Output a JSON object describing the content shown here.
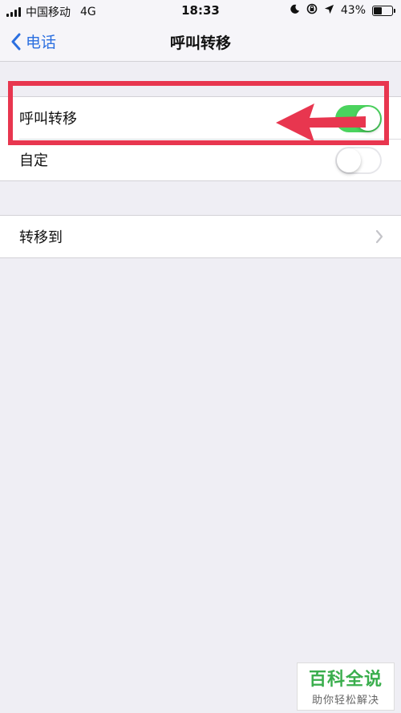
{
  "status_bar": {
    "carrier": "中国移动",
    "network": "4G",
    "time": "18:33",
    "battery_percent": "43%",
    "battery_level": 0.43,
    "icons": [
      "signal-icon",
      "moon-icon",
      "rotation-lock-icon",
      "location-icon",
      "battery-icon"
    ]
  },
  "nav": {
    "back_label": "电话",
    "title": "呼叫转移"
  },
  "settings": {
    "call_forwarding": {
      "label": "呼叫转移",
      "enabled": true
    },
    "custom": {
      "label": "自定",
      "enabled": false
    },
    "forward_to": {
      "label": "转移到"
    }
  },
  "watermark": {
    "title": "百科全说",
    "subtitle": "助你轻松解决"
  },
  "colors": {
    "accent": "#2b6fe0",
    "toggle_on": "#4bd35e",
    "annotation": "#e8364f",
    "watermark_green": "#3aae4d"
  }
}
